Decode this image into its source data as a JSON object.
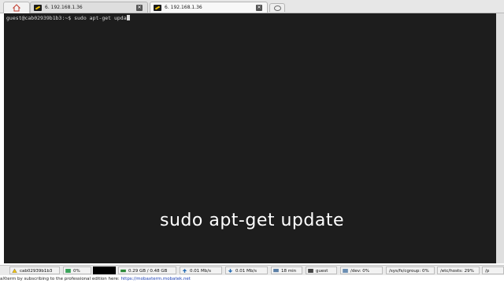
{
  "tabs": [
    {
      "label": "6. 192.168.1.36",
      "active": false
    },
    {
      "label": "6. 192.168.1.36",
      "active": true
    }
  ],
  "terminal": {
    "prompt": "guest@cab02939b1b3:~$ sudo apt-get upda",
    "background": "#1d1d1d",
    "text_color": "#dcdcdc"
  },
  "caption": "sudo apt-get update",
  "status": {
    "host": "cab02939b1b3",
    "cpu": "0%",
    "memory": "0.29 GB / 0.48 GB",
    "upload": "0.01 Mb/s",
    "download": "0.01 Mb/s",
    "uptime": "18 min",
    "user": "guest",
    "dev": "/dev: 0%",
    "cgroup": "/sys/fs/cgroup: 0%",
    "hosts": "/etc/hosts: 29%",
    "trail": "/p"
  },
  "footer": {
    "text": "aXterm by subscribing to the professional edition here:",
    "link": "https://mobaxterm.mobatek.net"
  }
}
